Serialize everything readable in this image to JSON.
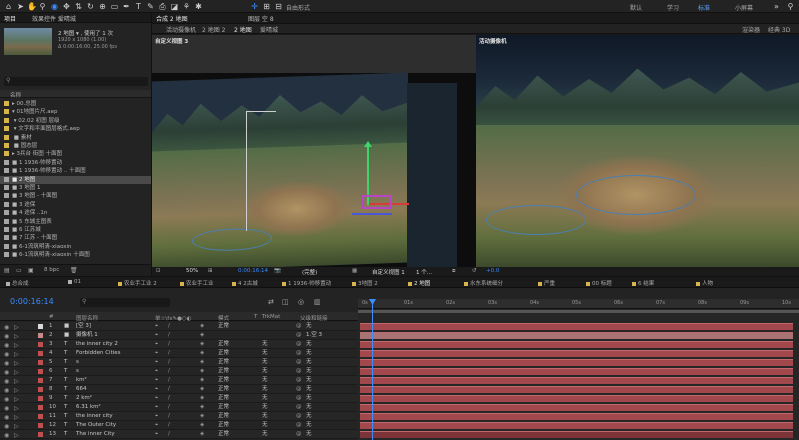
{
  "toolbar": {
    "workspaces": [
      "默认",
      "学习",
      "标准",
      "小屏幕"
    ],
    "active_workspace": "标准",
    "auto_label": "自由形式"
  },
  "project": {
    "tabs": [
      "项目",
      "效果控件 爱晴城"
    ],
    "footage_name": "2 地图 ▾ , 使用了 1 次",
    "footage_info1": "1920 x 1080 (1.00)",
    "footage_info2": "Δ 0:00:16:00, 25.00 fps",
    "col_name": "名称",
    "items": [
      {
        "text": "▸ 00.总图",
        "color": "#d6b64a",
        "sel": false
      },
      {
        "text": "▾ 01地图片尺.aep",
        "color": "#d6b64a",
        "sel": false
      },
      {
        "text": "   ▾ 02.02 初图 层级",
        "color": "#d6b64a",
        "sel": false
      },
      {
        "text": "      ▾ 文字和平面图层格式.aep",
        "color": "#d6b64a",
        "sel": false
      },
      {
        "text": "         ■ 素材",
        "color": "#d6b64a",
        "sel": false
      },
      {
        "text": "         ■ 固态层",
        "color": "#d6b64a",
        "sel": false
      },
      {
        "text": "▸ 3兵台  街图  十面图",
        "color": "#d6b64a",
        "sel": false
      },
      {
        "text": "■ 1 1936-帅移置动",
        "color": "#a6a6a6",
        "sel": false
      },
      {
        "text": "■ 1 1936-帅移置动 .. 十面图",
        "color": "#a6a6a6",
        "sel": false
      },
      {
        "text": "■ 2 地图",
        "color": "#a6a6a6",
        "sel": true
      },
      {
        "text": "■ 3 地图 1",
        "color": "#a6a6a6",
        "sel": false
      },
      {
        "text": "■ 3 地图 - 十面图",
        "color": "#a6a6a6",
        "sel": false
      },
      {
        "text": "■ 3 途保",
        "color": "#a6a6a6",
        "sel": false
      },
      {
        "text": "■ 4 途保 ..1n",
        "color": "#a6a6a6",
        "sel": false
      },
      {
        "text": "■ 5 东城主图表",
        "color": "#a6a6a6",
        "sel": false
      },
      {
        "text": "■ 6 江苏城",
        "color": "#a6a6a6",
        "sel": false
      },
      {
        "text": "■ 7 江苏 - 十面图",
        "color": "#a6a6a6",
        "sel": false
      },
      {
        "text": "■ 6-1流筑明清-xiaoxin",
        "color": "#a6a6a6",
        "sel": false
      },
      {
        "text": "■ 6-1流筑明清-xiaoxin  十面图",
        "color": "#a6a6a6",
        "sel": false
      }
    ],
    "bpc": "8 bpc"
  },
  "viewer": {
    "tab_label": "合成 2 地图",
    "tab_label2": "图层 空 8",
    "breadcrumb": [
      "活动摄像机",
      "2 地图 2",
      "2 地图",
      "爱晴城"
    ],
    "right_label1": "渲染器",
    "right_label2": "经典 3D",
    "left_view_label": "自定义视图 3",
    "right_view_label": "活动摄像机",
    "zoom": "50%",
    "time": "0:00:16:14",
    "res": "(完整)",
    "view_select": "自定义视图 1",
    "view_count": "1 个...",
    "exposure": "+0.0"
  },
  "timeline": {
    "tabs": [
      {
        "label": "总合成",
        "color": "#b0b0b0"
      },
      {
        "label": "01",
        "color": "#b0b0b0"
      },
      {
        "label": "农业手工业 2",
        "color": "#d6b64a"
      },
      {
        "label": "农业手工业",
        "color": "#d6b64a"
      },
      {
        "label": "4 2古城",
        "color": "#d6b64a"
      },
      {
        "label": "1 1936-帅移置动",
        "color": "#d6b64a"
      },
      {
        "label": "3地图 2",
        "color": "#d6b64a"
      },
      {
        "label": "2 地图",
        "color": "#d6b64a"
      },
      {
        "label": "水东系统细分",
        "color": "#d6b64a"
      },
      {
        "label": "严重",
        "color": "#d6b64a"
      },
      {
        "label": "00 标题",
        "color": "#d6b64a"
      },
      {
        "label": "6 结果",
        "color": "#d6b64a"
      },
      {
        "label": "人物",
        "color": "#d6b64a"
      }
    ],
    "active_tab": "2 地图",
    "timecode": "0:00:16:14",
    "headers": {
      "num": "#",
      "name": "图层名称",
      "switches": "单☆\\fx✎●○◐",
      "mode": "模式",
      "t": "T",
      "trkmat": "TrkMat",
      "parent": "父级和链接"
    },
    "ruler_ticks": [
      "0s",
      "01s",
      "02s",
      "03s",
      "04s",
      "05s",
      "06s",
      "07s",
      "08s",
      "09s",
      "10s"
    ],
    "layers": [
      {
        "num": "1",
        "type": "■",
        "name": "[空 3]",
        "color": "#d9d9d9",
        "mode": "正常",
        "trk": "",
        "parent": "无",
        "bar": "bar"
      },
      {
        "num": "2",
        "type": "■",
        "name": "摄像机 1",
        "color": "#c58a8a",
        "mode": "",
        "trk": "",
        "parent": "1.空 3",
        "bar": "bar light"
      },
      {
        "num": "3",
        "type": "T",
        "name": "the inner city 2",
        "color": "#c05050",
        "mode": "正常",
        "trk": "无",
        "parent": "无",
        "bar": "bar"
      },
      {
        "num": "4",
        "type": "T",
        "name": "Forbidden Cities",
        "color": "#c05050",
        "mode": "正常",
        "trk": "无",
        "parent": "无",
        "bar": "bar"
      },
      {
        "num": "5",
        "type": "T",
        "name": "s",
        "color": "#c05050",
        "mode": "正常",
        "trk": "无",
        "parent": "无",
        "bar": "bar"
      },
      {
        "num": "6",
        "type": "T",
        "name": "s",
        "color": "#c05050",
        "mode": "正常",
        "trk": "无",
        "parent": "无",
        "bar": "bar"
      },
      {
        "num": "7",
        "type": "T",
        "name": "km²",
        "color": "#c05050",
        "mode": "正常",
        "trk": "无",
        "parent": "无",
        "bar": "bar"
      },
      {
        "num": "8",
        "type": "T",
        "name": "664",
        "color": "#c05050",
        "mode": "正常",
        "trk": "无",
        "parent": "无",
        "bar": "bar"
      },
      {
        "num": "9",
        "type": "T",
        "name": "2 km²",
        "color": "#c05050",
        "mode": "正常",
        "trk": "无",
        "parent": "无",
        "bar": "bar"
      },
      {
        "num": "10",
        "type": "T",
        "name": "6.31 km²",
        "color": "#c05050",
        "mode": "正常",
        "trk": "无",
        "parent": "无",
        "bar": "bar"
      },
      {
        "num": "11",
        "type": "T",
        "name": "the inner city",
        "color": "#c05050",
        "mode": "正常",
        "trk": "无",
        "parent": "无",
        "bar": "bar"
      },
      {
        "num": "12",
        "type": "T",
        "name": "The Outer City",
        "color": "#c05050",
        "mode": "正常",
        "trk": "无",
        "parent": "无",
        "bar": "bar"
      },
      {
        "num": "13",
        "type": "T",
        "name": "The inner City",
        "color": "#c05050",
        "mode": "正常",
        "trk": "无",
        "parent": "无",
        "bar": "bar dark"
      }
    ]
  }
}
